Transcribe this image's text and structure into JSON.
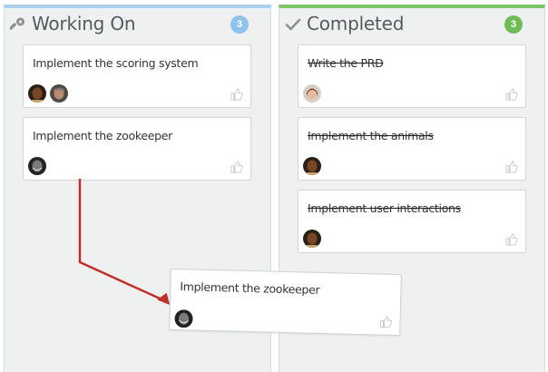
{
  "columns": {
    "working": {
      "title": "Working On",
      "count": "3",
      "accent": "#a9d1ef",
      "icon": "wrench-icon",
      "cards": [
        {
          "title": "Implement the scoring system",
          "avatars": [
            "avatar-dark-man",
            "avatar-gray-man"
          ]
        },
        {
          "title": "Implement the zookeeper",
          "avatars": [
            "avatar-bw-man"
          ]
        }
      ]
    },
    "done": {
      "title": "Completed",
      "count": "3",
      "accent": "#7cc66a",
      "icon": "checkmark-icon",
      "cards": [
        {
          "title": "Write the PRD",
          "avatars": [
            "avatar-woman"
          ]
        },
        {
          "title": "Implement the animals",
          "avatars": [
            "avatar-dark-man"
          ]
        },
        {
          "title": "Implement user interactions",
          "avatars": [
            "avatar-dark-man"
          ]
        }
      ]
    }
  },
  "dragging": {
    "title": "Implement the zookeeper",
    "avatars": [
      "avatar-bw-man"
    ]
  },
  "arrow_color": "#c0302a"
}
